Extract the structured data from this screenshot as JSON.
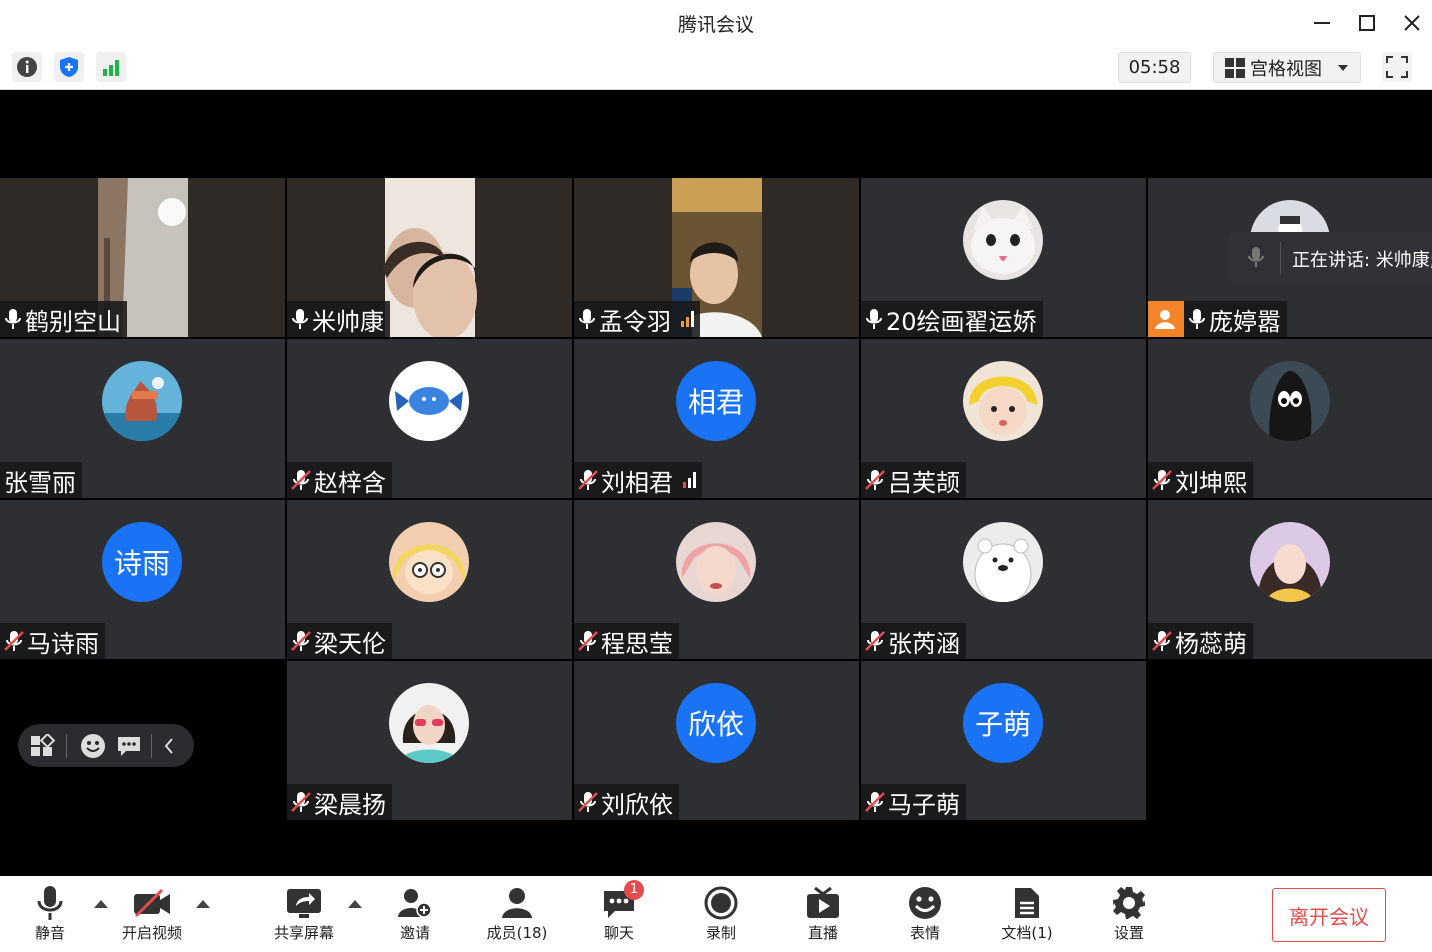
{
  "window": {
    "title": "腾讯会议"
  },
  "toolbar": {
    "timer": "05:58",
    "layout_label": "宫格视图"
  },
  "speaking": {
    "text": "正在讲话: 米帅康;"
  },
  "participants": [
    {
      "name": "鹤别空山",
      "mic": "on"
    },
    {
      "name": "米帅康",
      "mic": "on"
    },
    {
      "name": "孟令羽",
      "mic": "on"
    },
    {
      "name": "20绘画翟运娇",
      "mic": "on"
    },
    {
      "name": "庞婷嚣",
      "mic": "on"
    },
    {
      "name": "张雪丽",
      "mic": "none"
    },
    {
      "name": "赵梓含",
      "mic": "muted"
    },
    {
      "name": "刘相君",
      "mic": "muted",
      "avatar_text": "相君"
    },
    {
      "name": "吕芙颉",
      "mic": "muted"
    },
    {
      "name": "刘坤熙",
      "mic": "muted"
    },
    {
      "name": "马诗雨",
      "mic": "muted",
      "avatar_text": "诗雨"
    },
    {
      "name": "梁天伦",
      "mic": "muted"
    },
    {
      "name": "程思莹",
      "mic": "muted"
    },
    {
      "name": "张芮涵",
      "mic": "muted"
    },
    {
      "name": "杨蕊萌",
      "mic": "muted"
    },
    {
      "name": "梁晨扬",
      "mic": "muted"
    },
    {
      "name": "刘欣依",
      "mic": "muted",
      "avatar_text": "欣依"
    },
    {
      "name": "马子萌",
      "mic": "muted",
      "avatar_text": "子萌"
    }
  ],
  "bottombar": {
    "mute": "静音",
    "video": "开启视频",
    "share": "共享屏幕",
    "invite": "邀请",
    "members": "成员(18)",
    "chat": "聊天",
    "chat_badge": "1",
    "record": "录制",
    "live": "直播",
    "emoji": "表情",
    "docs": "文档(1)",
    "settings": "设置",
    "leave": "离开会议"
  },
  "colors": {
    "accent": "#1a73f5",
    "danger": "#e34d4d",
    "signal_good": "#21b24a",
    "signal_warn": "#f39a2b",
    "signal_bad": "#e34d4d"
  }
}
